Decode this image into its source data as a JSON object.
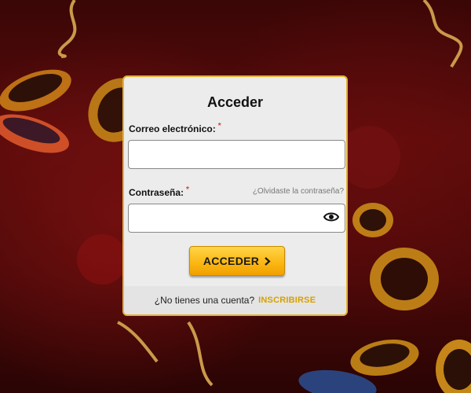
{
  "login": {
    "title": "Acceder",
    "email_label": "Correo electrónico:",
    "email_value": "",
    "password_label": "Contraseña:",
    "password_value": "",
    "required_mark": "*",
    "forgot_link": "¿Olvidaste la contraseña?",
    "submit_label": "ACCEDER",
    "no_account_text": "¿No tienes una cuenta?",
    "signup_link": "INSCRIBIRSE"
  },
  "icons": {
    "show_password": "eye-icon",
    "submit_arrow": "chevron-right-icon"
  },
  "colors": {
    "accent": "#fbb813",
    "card_border": "#e2b23a",
    "signup_link": "#d7a100",
    "required": "#d2452e",
    "background": "#4a0808"
  }
}
